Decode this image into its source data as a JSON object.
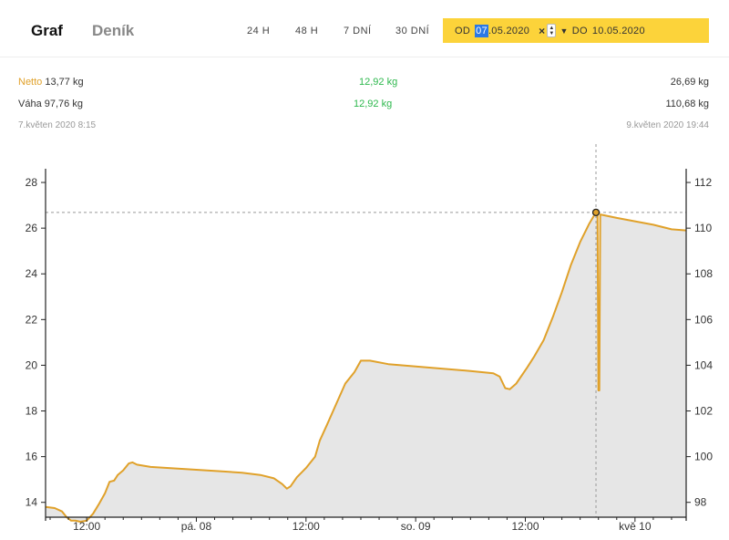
{
  "tabs": [
    {
      "label": "Graf",
      "active": true
    },
    {
      "label": "Deník",
      "active": false
    }
  ],
  "ranges": [
    "24 H",
    "48 H",
    "7 DNÍ",
    "30 DNÍ"
  ],
  "date_filter": {
    "from_label": "OD",
    "from_selected": "07",
    "from_rest": ".05.2020",
    "clear_icon": "×",
    "to_label": "DO",
    "to_value": "10.05.2020",
    "accent": "#fcd33a"
  },
  "stats": {
    "netto_label": "Netto",
    "netto_start": "13,77 kg",
    "netto_diff": "12,92 kg",
    "netto_end": "26,69 kg",
    "vaha_label": "Váha",
    "vaha_start": "97,76 kg",
    "vaha_diff": "12,92 kg",
    "vaha_end": "110,68 kg",
    "time_start": "7.květen 2020 8:15",
    "time_end": "9.květen 2020 19:44"
  },
  "chart_data": {
    "type": "area",
    "line_color": "#e0a12a",
    "fill_color": "#e6e6e6",
    "y_left_ticks": [
      14,
      16,
      18,
      20,
      22,
      24,
      26,
      28
    ],
    "y_right_ticks": [
      98,
      100,
      102,
      104,
      106,
      108,
      110,
      112
    ],
    "x_ticks": [
      "12:00",
      "pá. 08",
      "12:00",
      "so. 09",
      "12:00",
      "kvě 10"
    ],
    "x_tick_hours": [
      12,
      24,
      36,
      48,
      60,
      72
    ],
    "x_range_hours": [
      7.5,
      77.6
    ],
    "y_left_range": [
      13.35,
      28.6
    ],
    "x_unit": "hours from 7.5.2020 00:00",
    "y_unit": "Netto kg",
    "marker": {
      "x": 67.73,
      "y": 26.69
    },
    "points": [
      [
        7.5,
        13.8
      ],
      [
        8.5,
        13.75
      ],
      [
        9.3,
        13.6
      ],
      [
        9.8,
        13.35
      ],
      [
        10.3,
        13.2
      ],
      [
        10.8,
        13.2
      ],
      [
        11.3,
        13.15
      ],
      [
        12,
        13.2
      ],
      [
        12.7,
        13.5
      ],
      [
        13.3,
        13.9
      ],
      [
        14,
        14.4
      ],
      [
        14.5,
        14.9
      ],
      [
        15,
        14.95
      ],
      [
        15.4,
        15.2
      ],
      [
        16,
        15.4
      ],
      [
        16.6,
        15.7
      ],
      [
        17,
        15.75
      ],
      [
        17.5,
        15.65
      ],
      [
        19,
        15.55
      ],
      [
        21,
        15.5
      ],
      [
        23,
        15.45
      ],
      [
        25,
        15.4
      ],
      [
        27,
        15.35
      ],
      [
        29,
        15.3
      ],
      [
        31,
        15.2
      ],
      [
        32.5,
        15.05
      ],
      [
        33.4,
        14.8
      ],
      [
        33.9,
        14.6
      ],
      [
        34.3,
        14.7
      ],
      [
        35,
        15.1
      ],
      [
        36,
        15.5
      ],
      [
        37,
        16.0
      ],
      [
        37.5,
        16.7
      ],
      [
        38.3,
        17.4
      ],
      [
        39.3,
        18.3
      ],
      [
        40.3,
        19.2
      ],
      [
        41.3,
        19.7
      ],
      [
        42,
        20.2
      ],
      [
        43,
        20.2
      ],
      [
        45,
        20.05
      ],
      [
        48,
        19.95
      ],
      [
        51,
        19.85
      ],
      [
        54,
        19.75
      ],
      [
        56.5,
        19.65
      ],
      [
        57.2,
        19.5
      ],
      [
        57.8,
        19.0
      ],
      [
        58.3,
        18.95
      ],
      [
        59,
        19.2
      ],
      [
        60.2,
        19.9
      ],
      [
        61,
        20.4
      ],
      [
        62,
        21.1
      ],
      [
        63,
        22.1
      ],
      [
        64,
        23.2
      ],
      [
        65,
        24.4
      ],
      [
        66,
        25.4
      ],
      [
        67,
        26.2
      ],
      [
        67.73,
        26.69
      ],
      [
        67.9,
        26.69
      ],
      [
        68.0,
        18.9
      ],
      [
        68.1,
        18.9
      ],
      [
        68.2,
        26.6
      ],
      [
        70,
        26.45
      ],
      [
        72,
        26.3
      ],
      [
        74,
        26.15
      ],
      [
        76,
        25.95
      ],
      [
        77.6,
        25.9
      ]
    ]
  }
}
